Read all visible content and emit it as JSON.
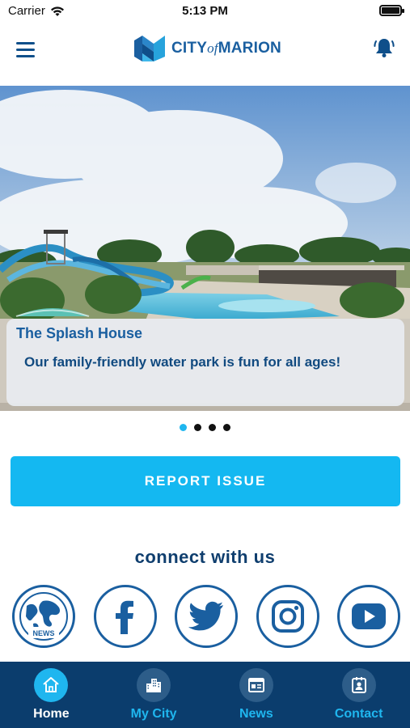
{
  "status_bar": {
    "carrier": "Carrier",
    "time": "5:13 PM"
  },
  "header": {
    "logo": {
      "city": "CITY",
      "of": "of",
      "name": "MARION"
    }
  },
  "hero": {
    "title": "The Splash House",
    "subtitle": "Our family-friendly water park is fun for all ages!",
    "slide_count": 4,
    "active_slide": 1
  },
  "report_button": {
    "label": "REPORT ISSUE"
  },
  "connect": {
    "title": "connect with us",
    "news_label": "NEWS",
    "socials": [
      "news-globe",
      "facebook",
      "twitter",
      "instagram",
      "youtube"
    ]
  },
  "tabbar": {
    "tabs": [
      {
        "label": "Home",
        "icon": "home-icon",
        "active": true
      },
      {
        "label": "My City",
        "icon": "city-icon",
        "active": false
      },
      {
        "label": "News",
        "icon": "news-icon",
        "active": false
      },
      {
        "label": "Contact",
        "icon": "contact-icon",
        "active": false
      }
    ]
  },
  "colors": {
    "primary": "#1a5fa0",
    "accent": "#14b8f1",
    "tabbar": "#0b3d6d"
  }
}
